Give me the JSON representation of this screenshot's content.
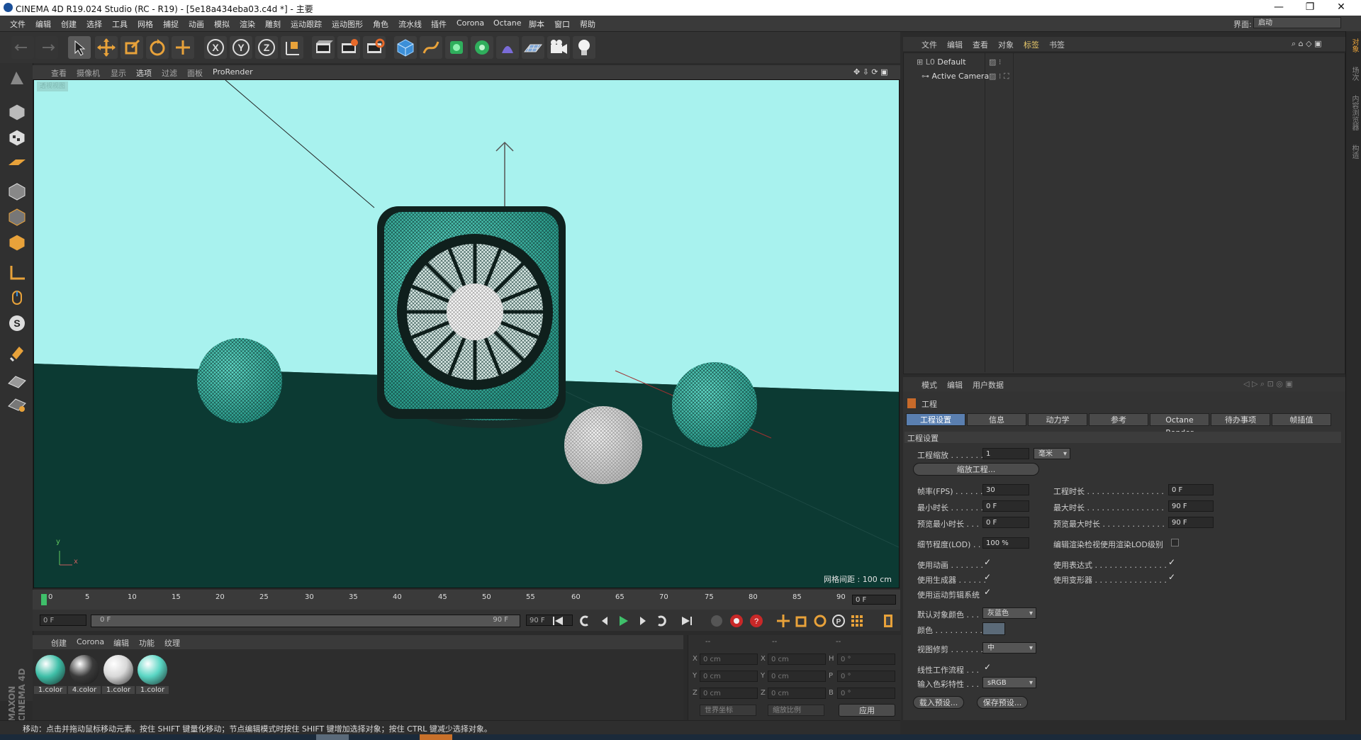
{
  "window": {
    "title": "CINEMA 4D R19.024 Studio (RC - R19) - [5e18a434eba03.c4d *] - 主要",
    "controls": [
      "—",
      "❐",
      "✕"
    ]
  },
  "menubar": {
    "items": [
      "文件",
      "编辑",
      "创建",
      "选择",
      "工具",
      "网格",
      "捕捉",
      "动画",
      "模拟",
      "渲染",
      "雕刻",
      "运动跟踪",
      "运动图形",
      "角色",
      "流水线",
      "插件",
      "Corona",
      "Octane",
      "脚本",
      "窗口",
      "帮助"
    ],
    "layout_label": "界面:",
    "layout_value": "启动"
  },
  "toolbar": {
    "icons": [
      "undo-icon",
      "redo-icon",
      "select-arrow-icon",
      "move-icon",
      "scale-icon",
      "rotate-icon",
      "live-move-icon",
      "x-axis-icon",
      "y-axis-icon",
      "z-axis-icon",
      "coordinate-system-icon",
      "render-view-icon",
      "render-picture-viewer-icon",
      "render-settings-icon",
      "cube-icon",
      "pen-spline-icon",
      "nurbs-icon",
      "array-icon",
      "deformer-icon",
      "floor-icon",
      "camera-icon",
      "light-icon"
    ]
  },
  "viewport": {
    "menu": [
      "查看",
      "摄像机",
      "显示",
      "选项",
      "过滤",
      "面板",
      "ProRender"
    ],
    "view_label": "透视视图",
    "grid_spacing": "网格间距 : 100 cm",
    "axis_x": "x",
    "axis_y": "y"
  },
  "timeline": {
    "ticks": [
      "0",
      "5",
      "10",
      "15",
      "20",
      "25",
      "30",
      "35",
      "40",
      "45",
      "50",
      "55",
      "60",
      "65",
      "70",
      "75",
      "80",
      "85",
      "90"
    ],
    "current_frame": "0 F"
  },
  "transport": {
    "start": "0 F",
    "range_start": "0 F",
    "range_end": "90 F",
    "end": "90 F"
  },
  "materials": {
    "menu": [
      "创建",
      "Corona",
      "编辑",
      "功能",
      "纹理"
    ],
    "items": [
      {
        "label": "1.color",
        "color": "#3fbfa8"
      },
      {
        "label": "4.color",
        "color": "#3a3a3a"
      },
      {
        "label": "1.color",
        "color": "#d8d8d8"
      },
      {
        "label": "1.color",
        "color": "#5ad6c4"
      }
    ],
    "logo": "MAXON CINEMA 4D"
  },
  "coordinates": {
    "headers": [
      "--",
      "--",
      "--"
    ],
    "rows": [
      {
        "a": "X",
        "av": "0 cm",
        "b": "X",
        "bv": "0 cm",
        "c": "H",
        "cv": "0 °"
      },
      {
        "a": "Y",
        "av": "0 cm",
        "b": "Y",
        "bv": "0 cm",
        "c": "P",
        "cv": "0 °"
      },
      {
        "a": "Z",
        "av": "0 cm",
        "b": "Z",
        "bv": "0 cm",
        "c": "B",
        "cv": "0 °"
      }
    ],
    "world": "世界坐标",
    "scale": "缩放比例",
    "apply": "应用"
  },
  "status": {
    "text": "移动：点击并拖动鼠标移动元素。按住 SHIFT 键量化移动；节点编辑模式时按住 SHIFT 键增加选择对象；按住 CTRL 键减少选择对象。"
  },
  "objects": {
    "menu": [
      "文件",
      "编辑",
      "查看",
      "对象",
      "标签",
      "书签"
    ],
    "rows": [
      {
        "name": "Default"
      },
      {
        "name": "Active Camera"
      }
    ]
  },
  "attributes": {
    "menu": [
      "模式",
      "编辑",
      "用户数据"
    ],
    "header": "工程",
    "tabs": [
      "工程设置",
      "信息",
      "动力学",
      "参考",
      "Octane Render",
      "待办事项",
      "帧插值"
    ],
    "section": "工程设置",
    "scale_label": "工程缩放 . . . . . . . .",
    "scale_value": "1",
    "scale_unit": "毫米",
    "scale_button": "缩放工程...",
    "fps_label": "帧率(FPS) . . . . . .",
    "fps_value": "30",
    "duration_label": "工程时长 . . . . . . . . . . . . . . . .",
    "duration_value": "0 F",
    "min_label": "最小时长 . . . . . . .",
    "min_value": "0 F",
    "max_label": "最大时长 . . . . . . . . . . . . . . . .",
    "max_value": "90 F",
    "pmin_label": "预览最小时长 . . .",
    "pmin_value": "0 F",
    "pmax_label": "预览最大时长 . . . . . . . . . . . . .",
    "pmax_value": "90 F",
    "lod_label": "细节程度(LOD) . . .",
    "lod_value": "100 %",
    "lod_render_label": "编辑渲染检视使用渲染LOD级别",
    "anim_label": "使用动画 . . . . . . .",
    "expr_label": "使用表达式 . . . . . . . . . . . . . . .",
    "gen_label": "使用生成器 . . . . . .",
    "deform_label": "使用变形器 . . . . . . . . . . . . . . .",
    "motion_label": "使用运动剪辑系统",
    "objcolor_label": "默认对象颜色 . . .",
    "objcolor_value": "灰蓝色",
    "color_label": "颜色 . . . . . . . . . . .",
    "clip_label": "视图修剪 . . . . . . .",
    "clip_value": "中",
    "linear_label": "线性工作流程 . . .",
    "input_label": "输入色彩特性 . . .",
    "input_value": "sRGB",
    "load_preset": "载入预设...",
    "save_preset": "保存预设..."
  },
  "right_tabs": [
    "对象",
    "场次",
    "内容浏览器",
    "构造"
  ]
}
